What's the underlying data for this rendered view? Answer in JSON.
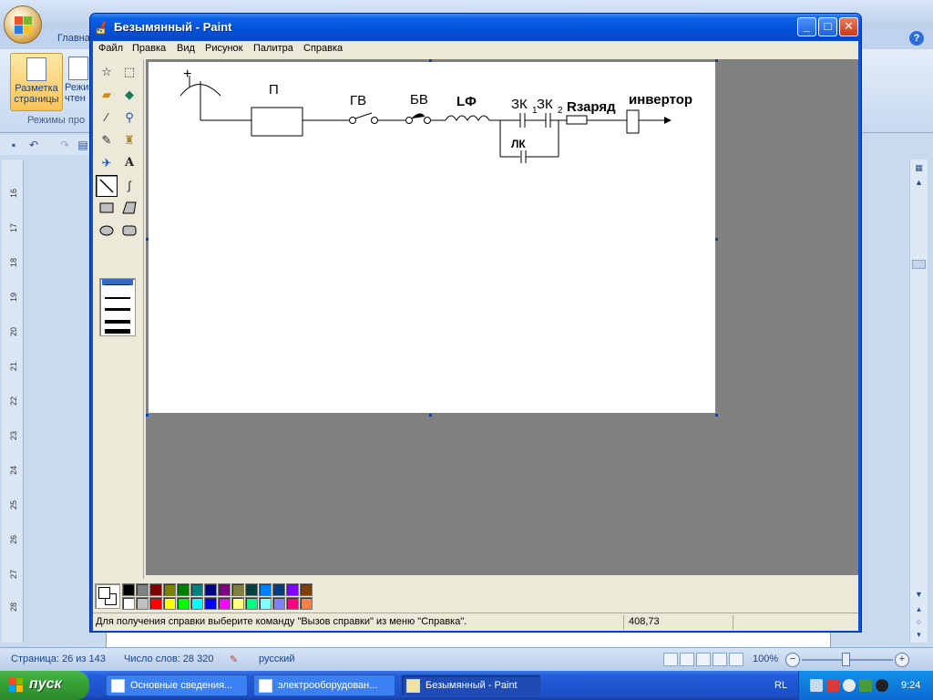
{
  "word": {
    "tabs": [
      "Главна"
    ],
    "ribbon_btn1_line1": "Разметка",
    "ribbon_btn1_line2": "страницы",
    "ribbon_btn2_line1": "Режи",
    "ribbon_btn2_line2": "чтен",
    "group_label": "Режимы про",
    "ruler_numbers": [
      "16",
      "17",
      "18",
      "19",
      "20",
      "21",
      "22",
      "23",
      "24",
      "25",
      "26",
      "27",
      "28"
    ],
    "status": {
      "page": "Страница: 26 из 143",
      "words": "Число слов: 28 320",
      "lang": "русский",
      "zoom": "100%"
    }
  },
  "paint": {
    "title": "Безымянный - Paint",
    "menu": [
      "Файл",
      "Правка",
      "Вид",
      "Рисунок",
      "Палитра",
      "Справка"
    ],
    "status_help": "Для получения справки выберите команду \"Вызов справки\" из меню \"Справка\".",
    "status_coords": "408,73",
    "canvas": {
      "labels": {
        "plus": "+",
        "p": "П",
        "gv": "ГВ",
        "bv": "БВ",
        "lf": "LФ",
        "zk1": "ЗК",
        "zk1_sub": "1",
        "zk2": "ЗК",
        "zk2_sub": "2",
        "rzaryad": "Rзаряд",
        "lk": "ЛК",
        "invertor": "инвертор"
      }
    },
    "palette": {
      "row1": [
        "#000000",
        "#808080",
        "#800000",
        "#808000",
        "#008000",
        "#008080",
        "#000080",
        "#800080",
        "#808040",
        "#004040",
        "#0080ff",
        "#004080",
        "#8000ff",
        "#804000"
      ],
      "row2": [
        "#ffffff",
        "#c0c0c0",
        "#ff0000",
        "#ffff00",
        "#00ff00",
        "#00ffff",
        "#0000ff",
        "#ff00ff",
        "#ffff80",
        "#00ff80",
        "#80ffff",
        "#8080ff",
        "#ff0080",
        "#ff8040"
      ]
    }
  },
  "taskbar": {
    "start": "пуск",
    "tasks": [
      "Основные сведения...",
      "электрооборудован...",
      "Безымянный - Paint"
    ],
    "lang": "RL",
    "time": "9:24"
  }
}
